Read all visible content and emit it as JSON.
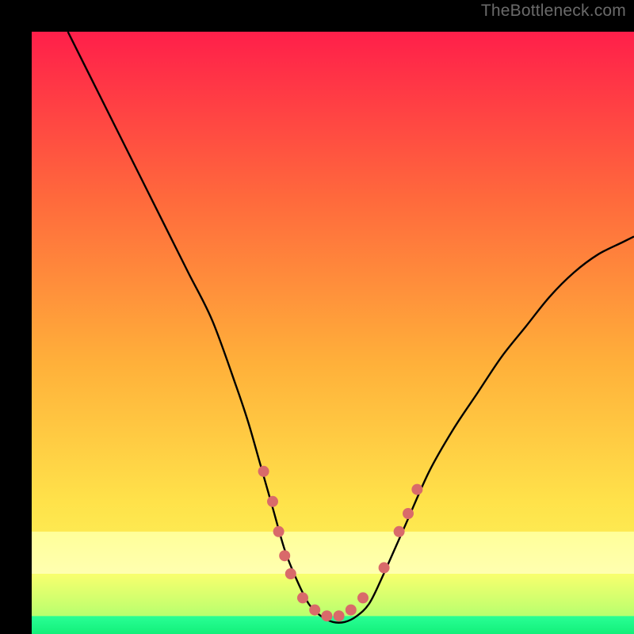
{
  "watermark": "TheBottleneck.com",
  "chart_data": {
    "type": "line",
    "title": "",
    "xlabel": "",
    "ylabel": "",
    "xlim": [
      0,
      100
    ],
    "ylim": [
      0,
      100
    ],
    "grid": false,
    "curve": {
      "name": "bottleneck-curve",
      "color": "#000000",
      "x": [
        6,
        10,
        14,
        18,
        22,
        26,
        30,
        34,
        36,
        38,
        40,
        42,
        44,
        46,
        48,
        50,
        52,
        54,
        56,
        58,
        62,
        66,
        70,
        74,
        78,
        82,
        86,
        90,
        94,
        98,
        100
      ],
      "y": [
        100,
        92,
        84,
        76,
        68,
        60,
        52,
        41,
        35,
        28,
        21,
        14,
        9,
        5,
        3,
        2,
        2,
        3,
        5,
        9,
        18,
        27,
        34,
        40,
        46,
        51,
        56,
        60,
        63,
        65,
        66
      ]
    },
    "markers": {
      "name": "highlight-points",
      "color": "#d96a6a",
      "radius": 7,
      "points": [
        {
          "x": 38.5,
          "y": 27
        },
        {
          "x": 40.0,
          "y": 22
        },
        {
          "x": 41.0,
          "y": 17
        },
        {
          "x": 42.0,
          "y": 13
        },
        {
          "x": 43.0,
          "y": 10
        },
        {
          "x": 45.0,
          "y": 6
        },
        {
          "x": 47.0,
          "y": 4
        },
        {
          "x": 49.0,
          "y": 3
        },
        {
          "x": 51.0,
          "y": 3
        },
        {
          "x": 53.0,
          "y": 4
        },
        {
          "x": 55.0,
          "y": 6
        },
        {
          "x": 58.5,
          "y": 11
        },
        {
          "x": 61.0,
          "y": 17
        },
        {
          "x": 62.5,
          "y": 20
        },
        {
          "x": 64.0,
          "y": 24
        }
      ]
    },
    "bands": [
      {
        "name": "green-band",
        "y_from": 0,
        "y_to": 3,
        "color_top": "#2aff95",
        "color_bot": "#12f07a"
      },
      {
        "name": "lime-band",
        "y_from": 3,
        "y_to": 10,
        "color_top": "#f9ff6e",
        "color_bot": "#b8ff6e"
      },
      {
        "name": "cream-band",
        "y_from": 10,
        "y_to": 17,
        "color_top": "#ffff99",
        "color_bot": "#ffffb0"
      }
    ],
    "background_gradient": {
      "top": "#ff1f4a",
      "mid_upper": "#ff6a3c",
      "mid": "#ffb03a",
      "mid_lower": "#ffe24a",
      "lower": "#f7ff66"
    }
  }
}
